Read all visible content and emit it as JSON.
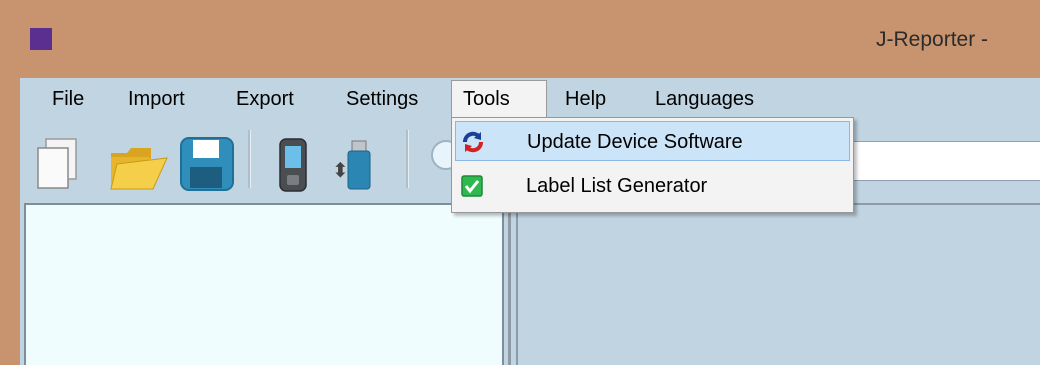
{
  "window": {
    "title": "J-Reporter -"
  },
  "menubar": {
    "items": [
      "File",
      "Import",
      "Export",
      "Settings",
      "Tools",
      "Help",
      "Languages"
    ]
  },
  "tools_menu": {
    "items": [
      {
        "label": "Update Device Software",
        "icon": "update-icon",
        "highlighted": true
      },
      {
        "label": "Label List Generator",
        "icon": "checkbox-icon",
        "highlighted": false
      }
    ]
  },
  "toolbar": {
    "icons": [
      "new-document-icon",
      "open-folder-icon",
      "save-icon",
      "device-icon",
      "usb-drive-icon",
      "search-icon"
    ]
  },
  "colors": {
    "titlebar": "#c8936f",
    "app_icon": "#5b2f8f",
    "body": "#c0d4e2",
    "tree_pane": "#f0fdff",
    "menu_highlight": "#cce4f7"
  }
}
